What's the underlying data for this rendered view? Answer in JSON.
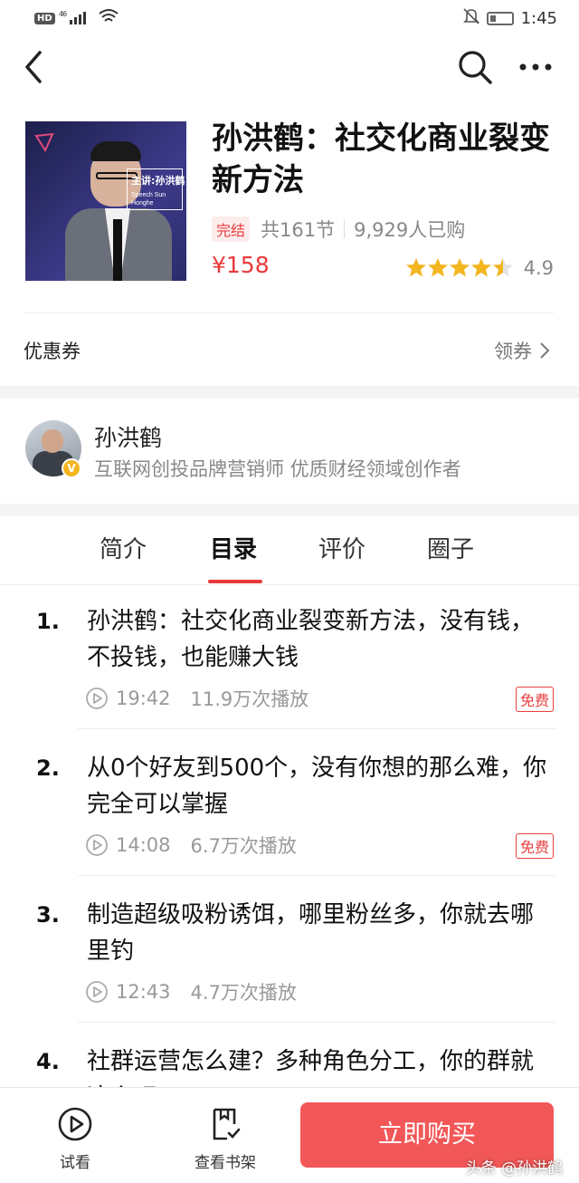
{
  "status_bar": {
    "network": "HD",
    "signal": "46",
    "time": "1:45"
  },
  "icons": {
    "back": "chevron-left-icon",
    "search": "search-icon",
    "more": "more-dots-icon"
  },
  "course": {
    "cover_label": "主讲:孙洪鹤",
    "cover_label_en": "Speech Sun Honghe",
    "title": "孙洪鹤：社交化商业裂变新方法",
    "status_badge": "完结",
    "lesson_count": "共161节",
    "buyers": "9,929人已购",
    "price": "¥158",
    "rating_value": 4.5,
    "rating_text": "4.9"
  },
  "coupon": {
    "label": "优惠券",
    "action": "领券"
  },
  "author": {
    "name": "孙洪鹤",
    "badge": "V",
    "description": "互联网创投品牌营销师 优质财经领域创作者"
  },
  "tabs": [
    {
      "label": "简介"
    },
    {
      "label": "目录",
      "active": true
    },
    {
      "label": "评价"
    },
    {
      "label": "圈子"
    }
  ],
  "lessons": [
    {
      "num": "1.",
      "title": "孙洪鹤：社交化商业裂变新方法，没有钱，不投钱，也能赚大钱",
      "duration": "19:42",
      "plays": "11.9万次播放",
      "free": "免费"
    },
    {
      "num": "2.",
      "title": "从0个好友到500个，没有你想的那么难，你完全可以掌握",
      "duration": "14:08",
      "plays": "6.7万次播放",
      "free": "免费"
    },
    {
      "num": "3.",
      "title": "制造超级吸粉诱饵，哪里粉丝多，你就去哪里钓",
      "duration": "12:43",
      "plays": "4.7万次播放",
      "free": ""
    },
    {
      "num": "4.",
      "title": "社群运营怎么建？多种角色分工，你的群就这么玩",
      "duration": "",
      "plays": "",
      "free": ""
    }
  ],
  "bottom_bar": {
    "trial_label": "试看",
    "shelf_label": "查看书架",
    "buy_label": "立即购买",
    "watermark": "头条 @孙洪鹤"
  },
  "colors": {
    "accent": "#e83a3a",
    "buy_button": "#f25757",
    "star": "#f3b520"
  }
}
